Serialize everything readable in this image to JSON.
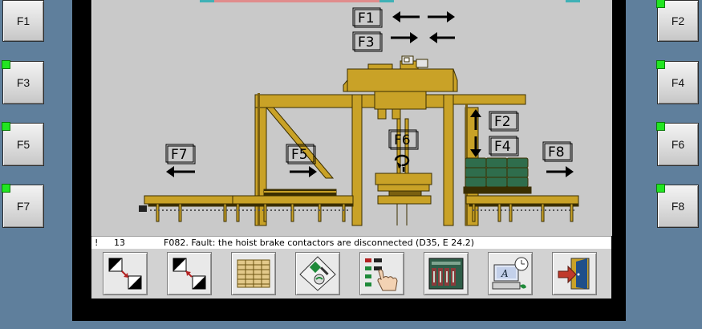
{
  "function_keys": {
    "f1": "F1",
    "f2": "F2",
    "f3": "F3",
    "f4": "F4",
    "f5": "F5",
    "f6": "F6",
    "f7": "F7",
    "f8": "F8"
  },
  "diagram_labels": {
    "f1": "F1",
    "f2": "F2",
    "f3": "F3",
    "f4": "F4",
    "f5": "F5",
    "f6": "F6",
    "f7": "F7",
    "f8": "F8"
  },
  "alarm": {
    "marker": "!",
    "number": "13",
    "message": "F082. Fault: the hoist brake contactors are disconnected (D35, E 24.2)"
  },
  "toolbar_icons": [
    "expand-diagonal-icon",
    "collapse-diagonal-icon",
    "pallet-stack-icon",
    "diagnostics-icon",
    "touch-panel-icon",
    "plc-rack-icon",
    "clock-terminal-icon",
    "exit-door-icon"
  ],
  "colors": {
    "machine": "#c9a227",
    "machine_outline": "#3a2e00",
    "load": "#2f6d4c",
    "led_on": "#22e522",
    "bezel": "#000000",
    "frame": "#5f7f9c"
  }
}
